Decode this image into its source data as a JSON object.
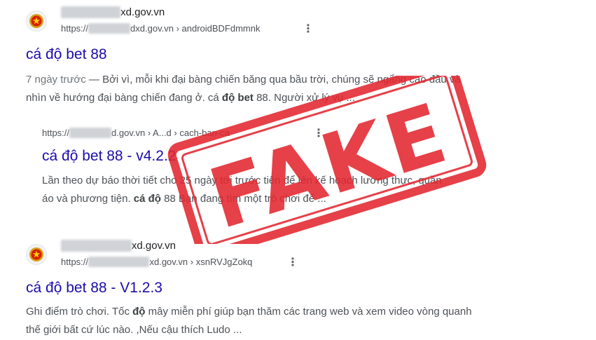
{
  "results": [
    {
      "site_blurred": "nangluchdxd",
      "site_visible": "xd.gov.vn",
      "url_prefix": "https://",
      "url_blurred": "nangluchd",
      "url_domain": "dxd.gov.vn",
      "url_path": " › androidBDFdmmnk",
      "title": "cá độ bet 88",
      "date": "7 ngày trước",
      "snippet_line1": " — Bởi vì, mỗi khi đại bàng chiến băng qua bầu trời, chúng sẽ ngẩng cao đầu và",
      "snippet_line2_a": "nhìn về hướng đại bàng chiến đang ở. cá ",
      "snippet_line2_bold": "độ bet",
      "snippet_line2_b": " 88. Người xử lý vụ ..."
    },
    {
      "url_prefix": "https://",
      "url_blurred": "nangluchd",
      "url_domain": "d.gov.vn › A",
      "url_path": "...d › cach-ban-ca",
      "title": "cá độ bet 88 - v4.2.2",
      "snippet_line1": "Lần theo dự báo thời tiết cho 25 ngày tới trước tiên để lên kế hoạch lương thực, quần",
      "snippet_line2_a": "áo và phương tiện. ",
      "snippet_line2_bold": "cá độ",
      "snippet_line2_b": " 88 Bạn đang tìm một trò chơi để ..."
    },
    {
      "site_blurred": "congtyxaydung",
      "site_visible": "xd.gov.vn",
      "url_prefix": "https://",
      "url_blurred": "congtyxaydung",
      "url_domain": "xd.gov.vn",
      "url_path": " › xsnRVJgZokq",
      "title": "cá độ bet 88 - V1.2.3",
      "snippet_line1_a": "Ghi điểm trò chơi. Tốc ",
      "snippet_line1_bold": "độ",
      "snippet_line1_b": " mây miễn phí giúp bạn thăm các trang web và xem video vòng quanh",
      "snippet_line2": "thế giới bất cứ lúc nào. ,Nếu cậu thích Ludo ..."
    }
  ],
  "stamp": {
    "text": "FAKE",
    "color": "#e3262f"
  },
  "kebab_glyph": "⋮",
  "icon_names": [
    "vietnam-emblem-icon",
    "more-options-icon"
  ]
}
